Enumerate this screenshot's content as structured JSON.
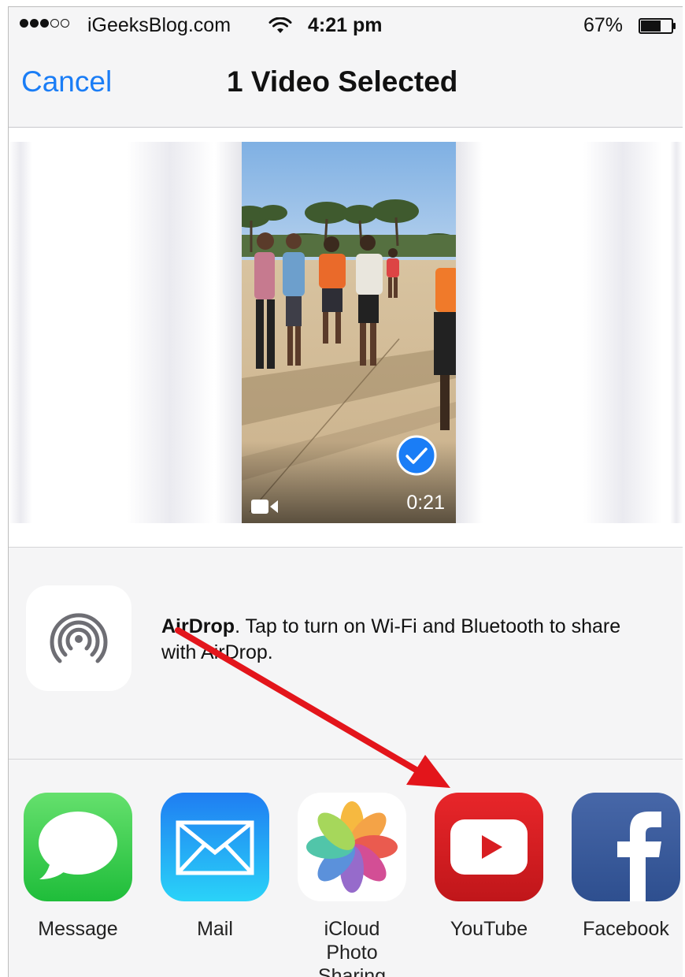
{
  "status_bar": {
    "carrier": "iGeeksBlog.com",
    "time": "4:21 pm",
    "battery": "67%",
    "signal_bars_filled": 3,
    "signal_bars_total": 5,
    "battery_level": 0.67
  },
  "nav": {
    "cancel_label": "Cancel",
    "title": "1 Video Selected"
  },
  "video": {
    "duration": "0:21",
    "selected": true
  },
  "airdrop": {
    "title": "AirDrop",
    "message": ". Tap to turn on Wi-Fi and Bluetooth to share with AirDrop."
  },
  "share_apps": [
    {
      "label": "Message",
      "icon": "message-icon"
    },
    {
      "label": "Mail",
      "icon": "mail-icon"
    },
    {
      "label": "iCloud Photo Sharing",
      "icon": "photos-icon"
    },
    {
      "label": "YouTube",
      "icon": "youtube-icon"
    },
    {
      "label": "Facebook",
      "icon": "facebook-icon"
    }
  ],
  "colors": {
    "accent": "#1a7df6",
    "annotation_arrow": "#e3151b"
  }
}
